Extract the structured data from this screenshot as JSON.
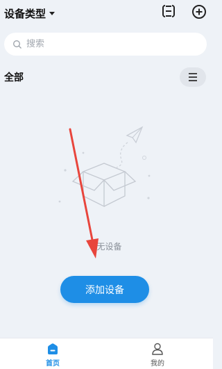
{
  "header": {
    "title": "设备类型",
    "scan_icon": "scan-icon",
    "add_icon": "plus-circle-icon"
  },
  "search": {
    "placeholder": "搜索"
  },
  "section": {
    "title": "全部",
    "menu_icon": "list-menu-icon"
  },
  "empty_state": {
    "text": "无设备",
    "illustration": "empty-box-with-paper-plane"
  },
  "actions": {
    "add_device_label": "添加设备"
  },
  "tabbar": {
    "items": [
      {
        "label": "首页",
        "icon": "home-icon",
        "active": true
      },
      {
        "label": "我的",
        "icon": "user-icon",
        "active": false
      }
    ]
  },
  "colors": {
    "accent": "#1e8ee6",
    "background": "#eef2f7",
    "annotation_arrow": "#e8453c"
  }
}
